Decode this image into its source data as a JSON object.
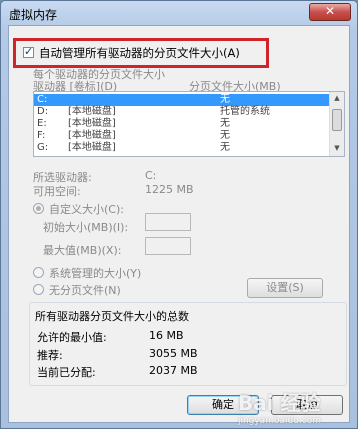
{
  "window": {
    "title": "虚拟内存",
    "close_glyph": "✕"
  },
  "auto_manage": {
    "label": "自动管理所有驱动器的分页文件大小(A)",
    "checked": true
  },
  "per_drive": {
    "section_label": "每个驱动器的分页文件大小",
    "col_drive": "驱动器 [卷标](D)",
    "col_size": "分页文件大小(MB)",
    "rows": [
      {
        "drive": "C:",
        "label": "",
        "size": "无",
        "selected": true
      },
      {
        "drive": "D:",
        "label": "[本地磁盘]",
        "size": "托管的系统",
        "selected": false
      },
      {
        "drive": "E:",
        "label": "[本地磁盘]",
        "size": "无",
        "selected": false
      },
      {
        "drive": "F:",
        "label": "[本地磁盘]",
        "size": "无",
        "selected": false
      },
      {
        "drive": "G:",
        "label": "[本地磁盘]",
        "size": "无",
        "selected": false
      }
    ]
  },
  "selected_drive": {
    "label": "所选驱动器:",
    "value": "C:",
    "space_label": "可用空间:",
    "space_value": "1225 MB"
  },
  "options": {
    "custom_label": "自定义大小(C):",
    "initial_label": "初始大小(MB)(I):",
    "max_label": "最大值(MB)(X):",
    "system_label": "系统管理的大小(Y)",
    "none_label": "无分页文件(N)",
    "set_button": "设置(S)"
  },
  "totals": {
    "section_label": "所有驱动器分页文件大小的总数",
    "min_label": "允许的最小值:",
    "min_value": "16 MB",
    "rec_label": "推荐:",
    "rec_value": "3055 MB",
    "cur_label": "当前已分配:",
    "cur_value": "2037 MB"
  },
  "buttons": {
    "ok": "确定",
    "cancel": "取消"
  },
  "watermark": {
    "brand": "Bai 经验",
    "url": "jingyan.baidu.com"
  },
  "colors": {
    "highlight": "#d0242b",
    "selection": "#3399ff"
  }
}
